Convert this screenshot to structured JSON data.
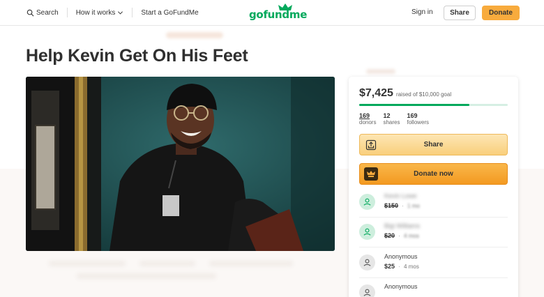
{
  "header": {
    "search_label": "Search",
    "how_label": "How it works",
    "start_label": "Start a GoFundMe",
    "logo_text": "gofundme",
    "signin_label": "Sign in",
    "share_label": "Share",
    "donate_label": "Donate"
  },
  "campaign": {
    "title": "Help Kevin Get On His Feet"
  },
  "card": {
    "raised_amount": "$7,425",
    "goal_text": "raised of $10,000 goal",
    "progress_fraction": 0.7425,
    "stats": [
      {
        "num": "169",
        "label": "donors"
      },
      {
        "num": "12",
        "label": "shares"
      },
      {
        "num": "169",
        "label": "followers"
      }
    ],
    "share_button": "Share",
    "donate_button": "Donate now",
    "donations": [
      {
        "name": "Kevin Lowe",
        "amount": "$150",
        "time": "1 mo"
      },
      {
        "name": "Bigi Williams",
        "amount": "$20",
        "time": "4 mos"
      },
      {
        "name": "Anonymous",
        "amount": "$25",
        "time": "4 mos"
      },
      {
        "name": "Anonymous",
        "amount": "",
        "time": ""
      }
    ]
  },
  "colors": {
    "brand_green": "#02a95c",
    "donate_orange": "#f8ab3d"
  }
}
